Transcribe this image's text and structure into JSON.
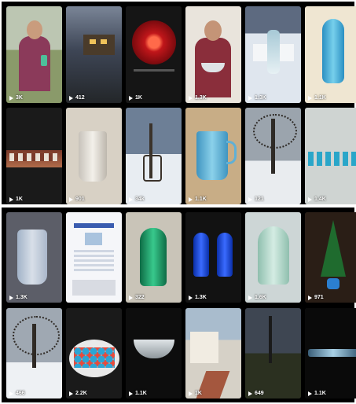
{
  "tiles_top": [
    {
      "views": "3K",
      "art": "man-window"
    },
    {
      "views": "412",
      "art": "dusk-yard"
    },
    {
      "views": "1K",
      "art": "red-plate"
    },
    {
      "views": "1.3K",
      "art": "man-bowl"
    },
    {
      "views": "1.3K",
      "art": "glass-stand"
    },
    {
      "views": "1.1K",
      "art": "blue-vase"
    },
    {
      "views": "1K",
      "art": "glass-shelf"
    },
    {
      "views": "901",
      "art": "clear-pitcher"
    },
    {
      "views": "34k",
      "art": "snow-yard"
    },
    {
      "views": "1.1K",
      "art": "blue-pitcher"
    },
    {
      "views": "121",
      "art": "snow-tree"
    },
    {
      "views": "1.4K",
      "art": "blue-glasses"
    }
  ],
  "tiles_bottom": [
    {
      "views": "1.3K",
      "art": "ice-pitcher"
    },
    {
      "views": "",
      "art": "flyer"
    },
    {
      "views": "322",
      "art": "green-epergne"
    },
    {
      "views": "1.3K",
      "art": "cobalt-vases"
    },
    {
      "views": "1.6K",
      "art": "green-vase"
    },
    {
      "views": "971",
      "art": "xmas-tree"
    },
    {
      "views": "466",
      "art": "winter-tree"
    },
    {
      "views": "2.2K",
      "art": "paperweights"
    },
    {
      "views": "1.1K",
      "art": "glass-bowl"
    },
    {
      "views": "1K",
      "art": "house-path"
    },
    {
      "views": "649",
      "art": "night-yard"
    },
    {
      "views": "1.1K",
      "art": "dark-dish"
    }
  ]
}
